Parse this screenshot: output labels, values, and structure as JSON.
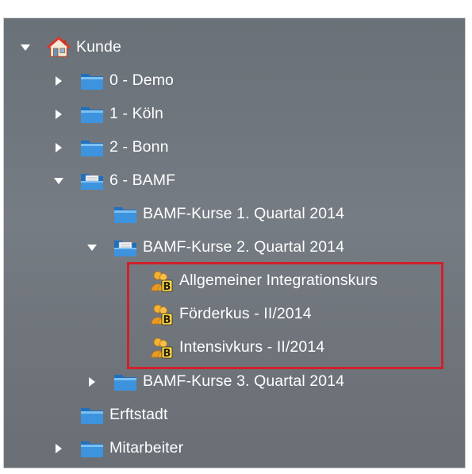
{
  "tree": {
    "root": {
      "label": "Kunde",
      "icon": "home-icon"
    },
    "items": [
      {
        "label": "0 - Demo",
        "icon": "folder-icon"
      },
      {
        "label": "1 - Köln",
        "icon": "folder-icon"
      },
      {
        "label": "2 - Bonn",
        "icon": "folder-icon"
      },
      {
        "label": "6 - BAMF",
        "icon": "open-folder-icon"
      },
      {
        "label": "BAMF-Kurse 1. Quartal 2014",
        "icon": "folder-icon"
      },
      {
        "label": "BAMF-Kurse 2. Quartal 2014",
        "icon": "open-folder-icon"
      },
      {
        "label": "Allgemeiner Integrationskurs",
        "icon": "course-group-icon"
      },
      {
        "label": "Förderkus - II/2014",
        "icon": "course-group-icon"
      },
      {
        "label": "Intensivkurs - II/2014",
        "icon": "course-group-icon"
      },
      {
        "label": "BAMF-Kurse 3. Quartal 2014",
        "icon": "folder-icon"
      },
      {
        "label": "Erftstadt",
        "icon": "folder-icon"
      },
      {
        "label": "Mitarbeiter",
        "icon": "folder-icon"
      }
    ]
  },
  "colors": {
    "panel_background": "#6e757c",
    "text": "#ffffff",
    "highlight_border": "#d21f2b",
    "folder_blue": "#3a8fd9"
  }
}
